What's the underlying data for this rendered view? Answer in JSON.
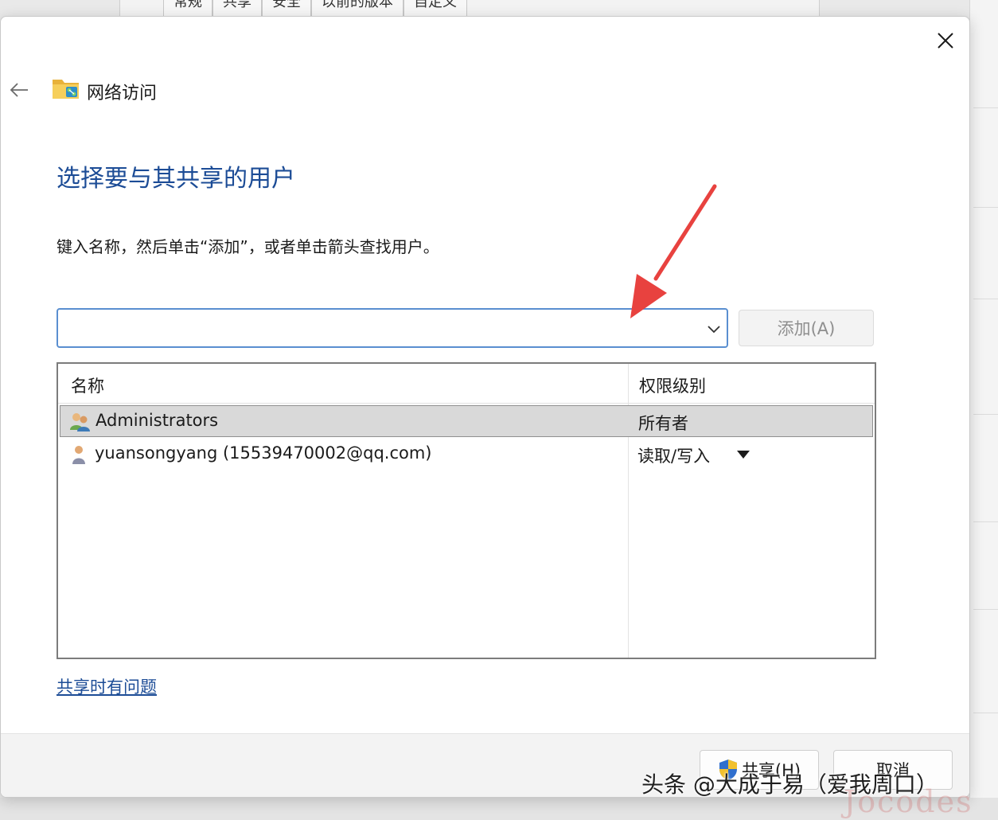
{
  "background": {
    "tabs": [
      "常规",
      "共享",
      "安全",
      "以前的版本",
      "自定义"
    ]
  },
  "dialog": {
    "header_title": "网络访问",
    "heading": "选择要与其共享的用户",
    "instruction": "键入名称，然后单击“添加”，或者单击箭头查找用户。",
    "name_input": {
      "value": "",
      "placeholder": ""
    },
    "add_button_label": "添加(A)",
    "list": {
      "columns": [
        "名称",
        "权限级别"
      ],
      "rows": [
        {
          "name": "Administrators",
          "permission": "所有者",
          "icon": "user-group-icon",
          "selected": true
        },
        {
          "name": "yuansongyang (15539470002@qq.com)",
          "permission": "读取/写入",
          "icon": "user-icon",
          "selected": false
        }
      ]
    },
    "help_link": "共享时有问题",
    "share_button_label": "共享(H)",
    "cancel_button_label": "取消"
  },
  "watermark": {
    "text": "头条 @大成于易（爱我周口）",
    "faint": "Jocodes"
  },
  "colors": {
    "heading": "#1c4c96",
    "input_border": "#5a8fd0",
    "selected_row": "#d9d9d9",
    "annotation_arrow": "#e8423f"
  }
}
